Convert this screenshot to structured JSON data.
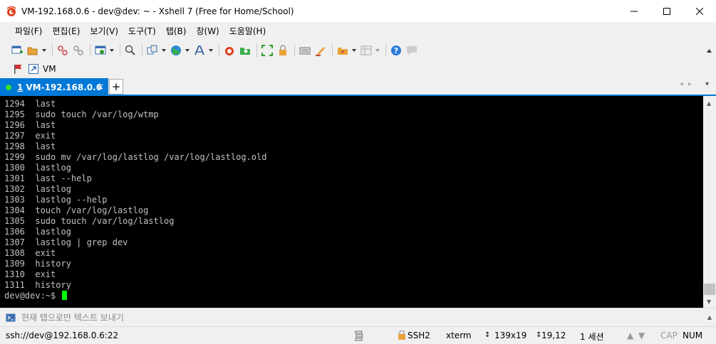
{
  "window": {
    "title": "VM-192.168.0.6 - dev@dev: ~ - Xshell 7 (Free for Home/School)"
  },
  "menu": {
    "items": [
      "파일(F)",
      "편집(E)",
      "보기(V)",
      "도구(T)",
      "탭(B)",
      "창(W)",
      "도움말(H)"
    ]
  },
  "links": {
    "vm_label": "VM"
  },
  "tabs": {
    "active_number": "1",
    "active_label": "VM-192.168.0.6",
    "close_glyph": "×",
    "add_glyph": "+"
  },
  "terminal": {
    "lines": [
      "1294  last",
      "1295  sudo touch /var/log/wtmp",
      "1296  last",
      "1297  exit",
      "1298  last",
      "1299  sudo mv /var/log/lastlog /var/log/lastlog.old",
      "1300  lastlog",
      "1301  last --help",
      "1302  lastlog",
      "1303  lastlog --help",
      "1304  touch /var/log/lastlog",
      "1305  sudo touch /var/log/lastlog",
      "1306  lastlog",
      "1307  lastlog | grep dev",
      "1308  exit",
      "1309  history",
      "1310  exit",
      "1311  history"
    ],
    "prompt": "dev@dev:~$ ",
    "cursor_color": "#00ff00",
    "background": "#000000",
    "foreground": "#c0c0c0"
  },
  "compose": {
    "placeholder": "현재 탭으로만 텍스트 보내기"
  },
  "status": {
    "connection": "ssh://dev@192.168.0.6:22",
    "protocol": "SSH2",
    "terminal_type": "xterm",
    "size": "139x19",
    "cursor_pos": "19,12",
    "sessions": "1 세션",
    "caps": "CAP",
    "num": "NUM"
  },
  "colors": {
    "accent": "#0078d7",
    "tab_indicator": "#2ee02e"
  },
  "icons": {
    "app": "xshell-logo-icon",
    "link_flag": "flag-icon",
    "link_vm": "shortcut-link-icon",
    "compose": "terminal-prompt-icon",
    "status_transfer": "transfer-icon",
    "status_lock": "lock-icon",
    "status_size": "resize-arrows-icon"
  }
}
